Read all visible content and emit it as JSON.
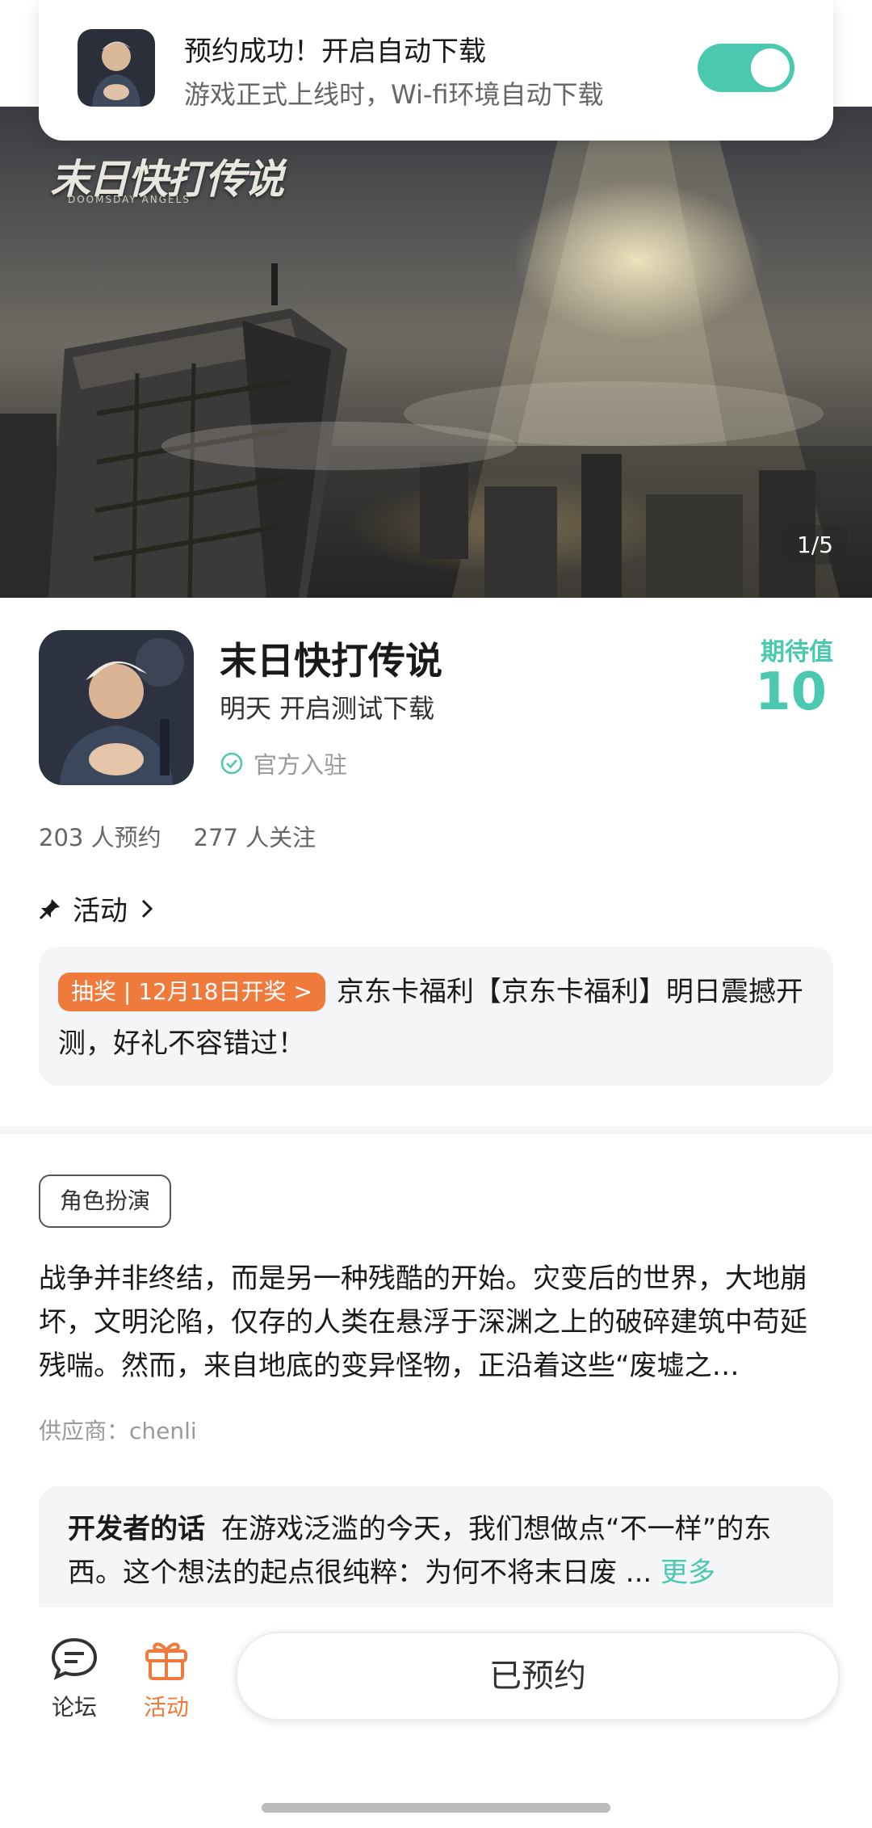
{
  "notification": {
    "title": "预约成功！开启自动下载",
    "subtitle": "游戏正式上线时，Wi-fi环境自动下载",
    "auto_download_enabled": true
  },
  "banner": {
    "logo_text": "末日快打传说",
    "logo_subtext": "DOOMSDAY ANGELS",
    "counter": "1/5"
  },
  "app": {
    "title": "末日快打传说",
    "subtitle": "明天 开启测试下载",
    "official": "官方入驻",
    "expectation_label": "期待值",
    "expectation_value": "10",
    "reservations": "203 人预约",
    "followers": "277 人关注"
  },
  "activity": {
    "heading": "活动",
    "badge": "抽奖 | 12月18日开奖 >",
    "text": "京东卡福利【京东卡福利】明日震撼开测，好礼不容错过！"
  },
  "description": {
    "tag": "角色扮演",
    "text": "战争并非终结，而是另一种残酷的开始。灾变后的世界，大地崩坏，文明沦陷，仅存的人类在悬浮于深渊之上的破碎建筑中苟延残喘。然而，来自地底的变异怪物，正沿着这些“废墟之…",
    "supplier": "供应商：chenli"
  },
  "developer": {
    "label": "开发者的话",
    "text": "在游戏泛滥的今天，我们想做点“不一样”的东西。这个想法的起点很纯粹：为何不将末日废 ...",
    "more": "更多"
  },
  "bottom_nav": {
    "forum": "论坛",
    "activity": "活动",
    "reserve_button": "已预约"
  },
  "colors": {
    "accent": "#4ac8b0",
    "badge": "#f07a3c"
  }
}
